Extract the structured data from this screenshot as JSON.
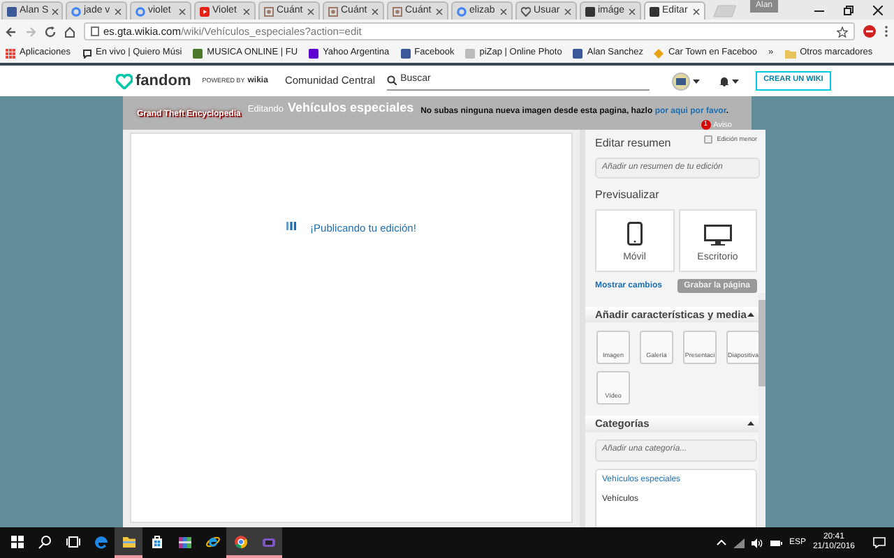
{
  "browser": {
    "tabs": [
      {
        "title": "Alan S",
        "selected": false,
        "kind": "square",
        "color": "#3b5998"
      },
      {
        "title": "jade v",
        "selected": false,
        "kind": "ring",
        "color": "#4285f4"
      },
      {
        "title": "violet",
        "selected": false,
        "kind": "ring",
        "color": "#4285f4"
      },
      {
        "title": "Violet",
        "selected": false,
        "kind": "play",
        "color": "#e62117"
      },
      {
        "title": "Cuánt",
        "selected": false,
        "kind": "frame",
        "color": "#9c7b6a"
      },
      {
        "title": "Cuánt",
        "selected": false,
        "kind": "frame",
        "color": "#9c7b6a"
      },
      {
        "title": "Cuánt",
        "selected": false,
        "kind": "frame",
        "color": "#9c7b6a"
      },
      {
        "title": "elizab",
        "selected": false,
        "kind": "ring",
        "color": "#4285f4"
      },
      {
        "title": "Usuar",
        "selected": false,
        "kind": "heart",
        "color": "#555555"
      },
      {
        "title": "imáge",
        "selected": false,
        "kind": "square",
        "color": "#333333"
      },
      {
        "title": "Editar",
        "selected": true,
        "kind": "square",
        "color": "#333333"
      }
    ],
    "profile": "Alan",
    "address": {
      "host": "es.gta.wikia.com",
      "path": "/wiki/Vehículos_especiales?action=edit"
    },
    "bookmarks": [
      {
        "label": "Aplicaciones",
        "kind": "grid",
        "color": "#e8453c"
      },
      {
        "label": "En vivo | Quiero Músi",
        "kind": "bubble",
        "color": "#333333"
      },
      {
        "label": "MUSICA ONLINE | FU",
        "kind": "square",
        "color": "#4a7a2a"
      },
      {
        "label": "Yahoo Argentina",
        "kind": "square",
        "color": "#5f01d1"
      },
      {
        "label": "Facebook",
        "kind": "square",
        "color": "#3b5998"
      },
      {
        "label": "piZap | Online Photo",
        "kind": "square",
        "color": "#bbbbbb"
      },
      {
        "label": "Alan Sanchez",
        "kind": "square",
        "color": "#3b5998"
      },
      {
        "label": "Car Town en Faceboo",
        "kind": "diamond",
        "color": "#e8a317"
      }
    ],
    "overflow": "»",
    "other_bookmarks": "Otros marcadores"
  },
  "fandom_bar": {
    "logo": "fandom",
    "powered_by": "POWERED BY",
    "powered_brand": "wikia",
    "community": "Comunidad Central",
    "search_placeholder": "Buscar",
    "create_button": "CREAR UN WIKI"
  },
  "wiki_header": {
    "wiki_name": "Grand Theft Encyclopedia",
    "editing_label": "Editando",
    "page_title": "Vehículos especiales",
    "notice": {
      "text": "No subas ninguna nueva imagen desde esta pagina, hazlo",
      "link": "por aqui por favor",
      "end": "."
    },
    "notice_count": "1",
    "notice_label": "Aviso"
  },
  "editor": {
    "status": "¡Publicando tu edición!"
  },
  "sidebar": {
    "summary_label": "Editar resumen",
    "minor_edit": {
      "label": "Edición menor",
      "checked": false
    },
    "summary_placeholder": "Añadir un resumen de tu edición",
    "preview_label": "Previsualizar",
    "preview_buttons": [
      {
        "label": "Móvil",
        "kind": "phone"
      },
      {
        "label": "Escritorio",
        "kind": "monitor"
      }
    ],
    "show_changes": "Mostrar cambios",
    "save_button": {
      "label": "Grabar la página",
      "disabled": true
    },
    "media": {
      "title": "Añadir características y media",
      "expanded": true,
      "items": [
        "Imagen",
        "Galería",
        "Presentaci",
        "Diapositiva",
        "Vídeo"
      ]
    },
    "categories": {
      "title": "Categorías",
      "expanded": true,
      "placeholder": "Añadir una categoría...",
      "items": [
        {
          "label": "Vehículos especiales",
          "kind": "link"
        },
        {
          "label": "Vehículos",
          "kind": "plain"
        }
      ]
    }
  },
  "taskbar": {
    "apps": [
      {
        "kind": "start",
        "active": false
      },
      {
        "kind": "search",
        "active": false
      },
      {
        "kind": "taskview",
        "active": false
      },
      {
        "kind": "edge",
        "active": false
      },
      {
        "kind": "folder",
        "active": true
      },
      {
        "kind": "store",
        "active": false
      },
      {
        "kind": "archive",
        "active": false
      },
      {
        "kind": "ie",
        "active": false
      },
      {
        "kind": "chrome",
        "active": true
      },
      {
        "kind": "app",
        "active": true
      }
    ],
    "language": "ESP",
    "time": "20:41",
    "date": "21/10/2016"
  }
}
